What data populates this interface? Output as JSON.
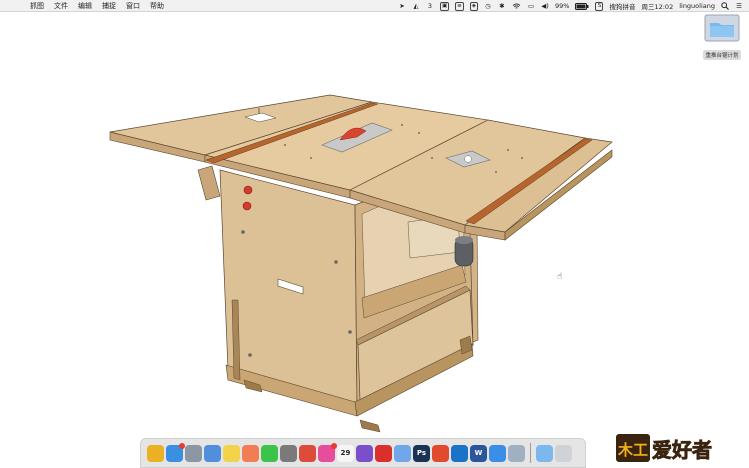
{
  "menubar": {
    "items": [
      "抓图",
      "文件",
      "编辑",
      "捕捉",
      "窗口",
      "帮助"
    ],
    "status": {
      "notification_count": "3",
      "battery": "99%",
      "input_method": "搜狗拼音",
      "clock": "周三12:02",
      "user": "linguoliang"
    }
  },
  "desktop": {
    "folder_label": "重推台锯计划"
  },
  "dock": {
    "apps": [
      {
        "icon": "chrome-icon",
        "color": "#e9b123"
      },
      {
        "icon": "finder-icon",
        "color": "#3b8fe0"
      },
      {
        "icon": "launchpad-icon",
        "color": "#8d96a3"
      },
      {
        "icon": "mail-icon",
        "color": "#4f8fdc"
      },
      {
        "icon": "notes-icon",
        "color": "#f4d34a"
      },
      {
        "icon": "photos-icon",
        "color": "#f27d55"
      },
      {
        "icon": "messages-icon",
        "color": "#3dc24b"
      },
      {
        "icon": "system-preferences-icon",
        "color": "#7a7a7a"
      },
      {
        "icon": "chrome-icon",
        "color": "#dd4b39"
      },
      {
        "icon": "itunes-icon",
        "color": "#e84d9b"
      },
      {
        "icon": "calendar-icon",
        "color": "#f5f5f5",
        "text": "29"
      },
      {
        "icon": "imovie-icon",
        "color": "#7b4fc9"
      },
      {
        "icon": "sketchup-icon",
        "color": "#d9302c"
      },
      {
        "icon": "xcode-icon",
        "color": "#6fa7e8"
      },
      {
        "icon": "photoshop-icon",
        "color": "#1a3354",
        "text": "Ps"
      },
      {
        "icon": "sketch-icon",
        "color": "#e24a2d"
      },
      {
        "icon": "teamviewer-icon",
        "color": "#1a73c7"
      },
      {
        "icon": "word-icon",
        "color": "#2b579a",
        "text": "W"
      },
      {
        "icon": "safari-icon",
        "color": "#3a8ee6"
      },
      {
        "icon": "preview-icon",
        "color": "#9fb0c2"
      }
    ],
    "folder": {
      "icon": "folder-icon",
      "color": "#7ab8ee"
    },
    "trash": {
      "icon": "trash-icon",
      "color": "#cfd3d8"
    }
  },
  "watermark": {
    "mark": "木工",
    "text": "爱好者"
  }
}
